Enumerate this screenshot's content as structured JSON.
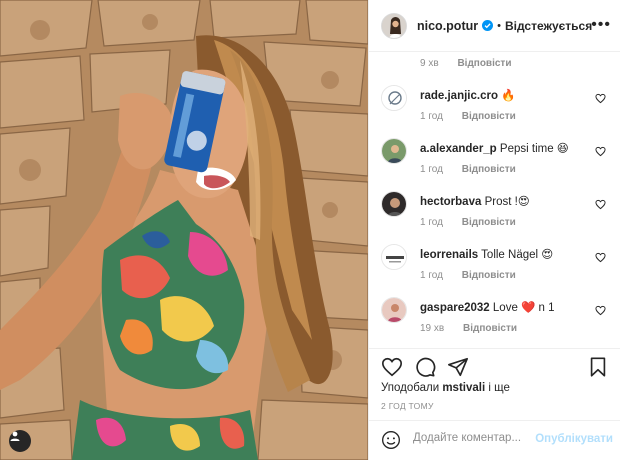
{
  "post": {
    "author": "nico.potur",
    "dot": "•",
    "follow_state": "Відстежується",
    "more": "•••",
    "hidden_comment": {
      "time": "9 хв",
      "reply": "Відповісти"
    }
  },
  "comments": [
    {
      "user": "rade.janjic.cro",
      "text": "🔥",
      "time": "1 год",
      "reply": "Відповісти"
    },
    {
      "user": "a.alexander_p",
      "text": "Pepsi time 😆",
      "time": "1 год",
      "reply": "Відповісти"
    },
    {
      "user": "hectorbava",
      "text": "Prost !😍",
      "time": "1 год",
      "reply": "Відповісти"
    },
    {
      "user": "leorrenails",
      "text": "Tolle Nägel 😍",
      "time": "1 год",
      "reply": "Відповісти"
    },
    {
      "user": "gaspare2032",
      "text": "Love ❤️ n 1",
      "time": "19 хв",
      "reply": "Відповісти"
    }
  ],
  "likes": {
    "prefix": "Уподобали",
    "user": "mstivali",
    "suffix": "і ще"
  },
  "timestamp": "2 ГОД ТОМУ",
  "composer": {
    "placeholder": "Додайте коментар...",
    "post_label": "Опублікувати"
  },
  "icons": {
    "heart": "heart-icon",
    "comment": "comment-icon",
    "share": "share-icon",
    "save": "bookmark-icon",
    "emoji": "emoji-icon",
    "tag": "user-tag-icon",
    "verified": "verified-badge-icon",
    "options": "more-options-icon"
  },
  "colors": {
    "verified": "#0095f6",
    "post_disabled": "#b2dffc",
    "secondary_text": "#8e8e8e"
  }
}
